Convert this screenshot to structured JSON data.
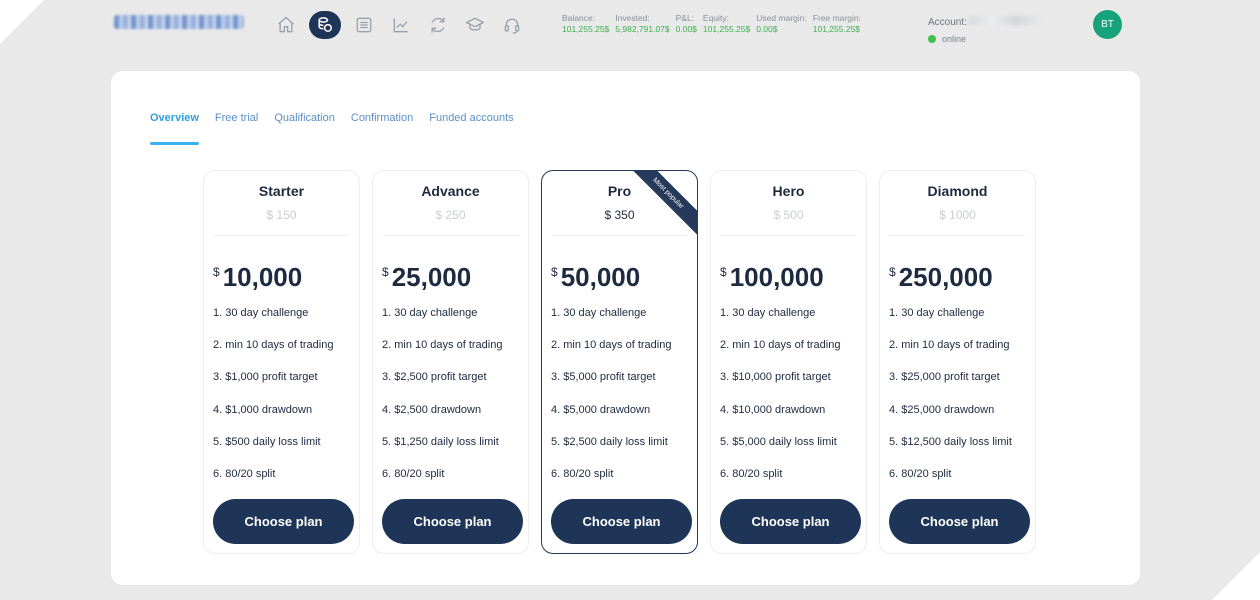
{
  "topbar": {
    "nav": [
      "home-icon",
      "coins-icon",
      "list-icon",
      "chart-icon",
      "refresh-icon",
      "graduation-cap-icon",
      "headset-icon"
    ],
    "stats": [
      {
        "label": "Balance:",
        "value": "101,255.25$"
      },
      {
        "label": "Invested:",
        "value": "5,982,791.07$"
      },
      {
        "label": "P&L:",
        "value": "0.00$"
      },
      {
        "label": "Equity:",
        "value": "101,255.25$"
      },
      {
        "label": "Used margin:",
        "value": "0.00$"
      },
      {
        "label": "Free margin:",
        "value": "101,255.25$"
      }
    ],
    "account_label": "Account:",
    "status": "online",
    "avatar": "BT"
  },
  "tabs": [
    "Overview",
    "Free trial",
    "Qualification",
    "Confirmation",
    "Funded accounts"
  ],
  "plans": [
    {
      "name": "Starter",
      "fee": "$ 150",
      "currency": "$",
      "amount": "10,000",
      "features": [
        "1. 30 day challenge",
        "2. min 10 days of trading",
        "3. $1,000 profit target",
        "4. $1,000 drawdown",
        "5. $500 daily loss limit",
        "6. 80/20 split"
      ],
      "button": "Choose plan"
    },
    {
      "name": "Advance",
      "fee": "$ 250",
      "currency": "$",
      "amount": "25,000",
      "features": [
        "1. 30 day challenge",
        "2. min 10 days of trading",
        "3. $2,500 profit target",
        "4. $2,500 drawdown",
        "5. $1,250 daily loss limit",
        "6. 80/20 split"
      ],
      "button": "Choose plan"
    },
    {
      "name": "Pro",
      "fee": "$ 350",
      "currency": "$",
      "amount": "50,000",
      "ribbon": "Most popular",
      "features": [
        "1. 30 day challenge",
        "2. min 10 days of trading",
        "3. $5,000 profit target",
        "4. $5,000 drawdown",
        "5. $2,500 daily loss limit",
        "6. 80/20 split"
      ],
      "button": "Choose plan"
    },
    {
      "name": "Hero",
      "fee": "$ 500",
      "currency": "$",
      "amount": "100,000",
      "features": [
        "1. 30 day challenge",
        "2. min 10 days of trading",
        "3. $10,000 profit target",
        "4. $10,000 drawdown",
        "5. $5,000 daily loss limit",
        "6. 80/20 split"
      ],
      "button": "Choose plan"
    },
    {
      "name": "Diamond",
      "fee": "$ 1000",
      "currency": "$",
      "amount": "250,000",
      "features": [
        "1. 30 day challenge",
        "2. min 10 days of trading",
        "3. $25,000 profit target",
        "4. $25,000 drawdown",
        "5. $12,500 daily loss limit",
        "6. 80/20 split"
      ],
      "button": "Choose plan"
    }
  ]
}
